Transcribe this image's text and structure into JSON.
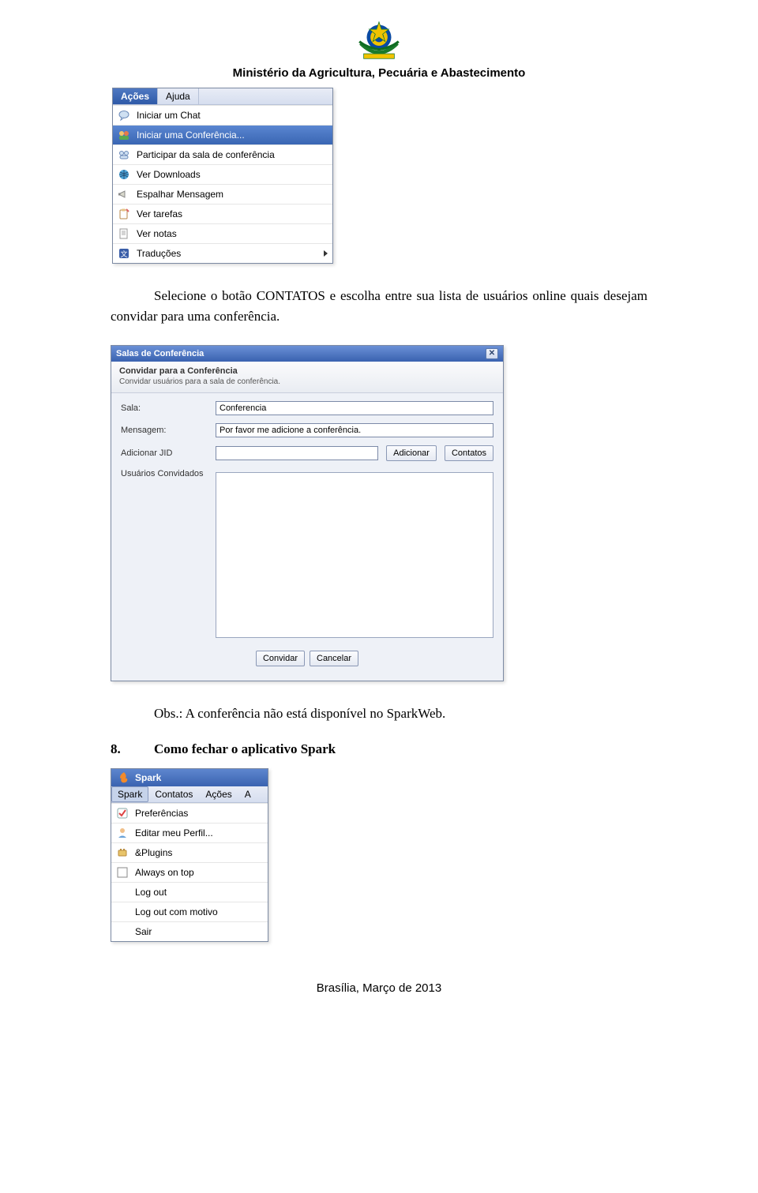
{
  "header": {
    "ministry": "Ministério da Agricultura, Pecuária e Abastecimento"
  },
  "menu1": {
    "menubar": [
      "Ações",
      "Ajuda"
    ],
    "items": [
      {
        "icon": "chat",
        "label": "Iniciar um Chat"
      },
      {
        "icon": "conf",
        "label": "Iniciar uma Conferência...",
        "highlight": true
      },
      {
        "icon": "join",
        "label": "Participar da sala de conferência"
      },
      {
        "icon": "down",
        "label": "Ver Downloads"
      },
      {
        "icon": "broad",
        "label": "Espalhar Mensagem"
      },
      {
        "icon": "task",
        "label": "Ver tarefas"
      },
      {
        "icon": "note",
        "label": "Ver notas"
      },
      {
        "icon": "trans",
        "label": "Traduções",
        "arrow": true
      }
    ]
  },
  "paragraph1": "Selecione o botão CONTATOS e escolha entre sua lista de usuários online quais desejam convidar para uma conferência.",
  "dialog": {
    "title": "Salas de Conferência",
    "sub_title": "Convidar para a Conferência",
    "sub_desc": "Convidar usuários para a sala de conferência.",
    "rows": {
      "sala_label": "Sala:",
      "sala_value": "Conferencia",
      "msg_label": "Mensagem:",
      "msg_value": "Por favor me adicione a conferência.",
      "jid_label": "Adicionar JID",
      "jid_value": "",
      "add_btn": "Adicionar",
      "contacts_btn": "Contatos",
      "invited_label": "Usuários Convidados"
    },
    "footer": {
      "invite": "Convidar",
      "cancel": "Cancelar"
    }
  },
  "obs": "Obs.: A conferência não está disponível no SparkWeb.",
  "section": {
    "num": "8.",
    "title": "Como fechar o aplicativo Spark"
  },
  "menu3": {
    "title": "Spark",
    "menubar": [
      "Spark",
      "Contatos",
      "Ações",
      "A"
    ],
    "items": [
      {
        "icon": "pref",
        "label": "Preferências"
      },
      {
        "icon": "prof",
        "label": "Editar meu Perfil..."
      },
      {
        "icon": "plug",
        "label": "&Plugins"
      },
      {
        "icon": "top",
        "label": "Always on top"
      },
      {
        "icon": "",
        "label": "Log out"
      },
      {
        "icon": "",
        "label": "Log out com motivo"
      },
      {
        "icon": "",
        "label": "Sair"
      }
    ]
  },
  "footer": "Brasília, Março de 2013"
}
